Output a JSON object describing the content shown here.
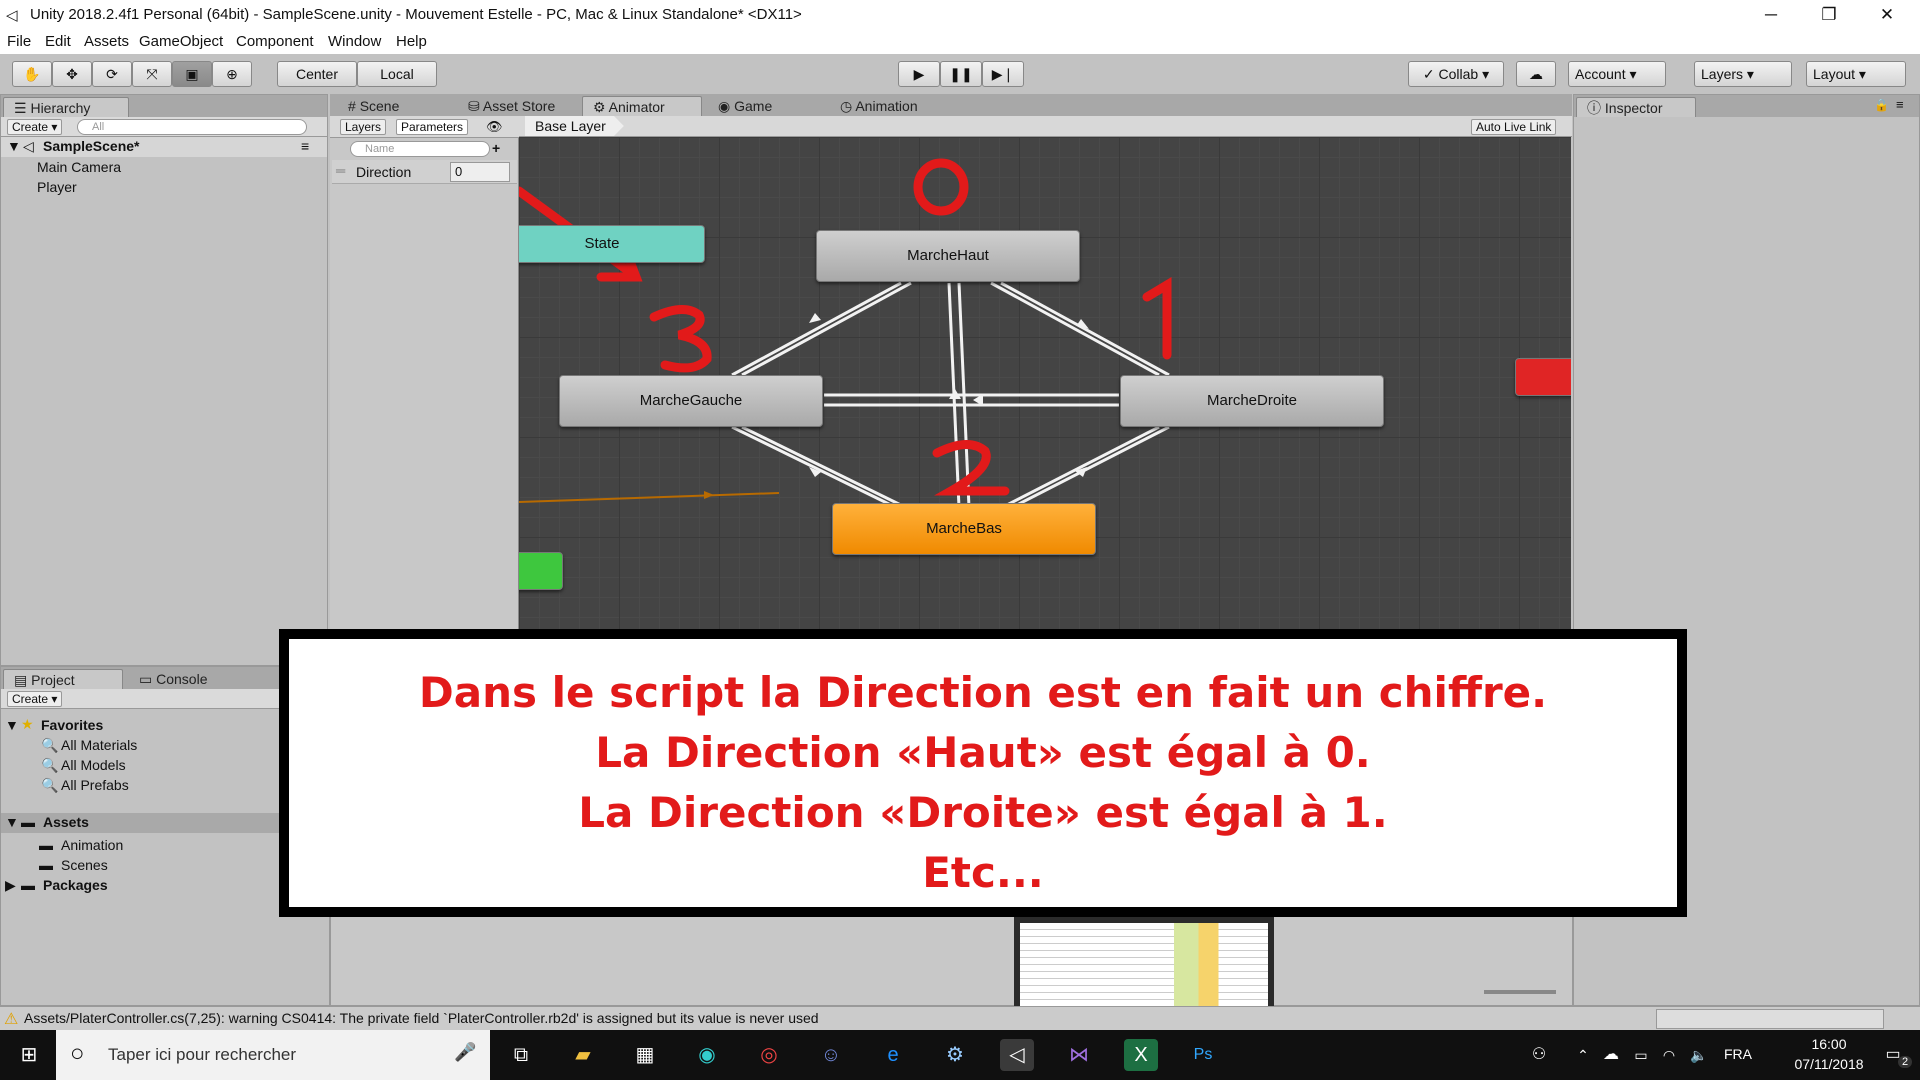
{
  "window": {
    "title": "Unity 2018.2.4f1 Personal (64bit) - SampleScene.unity - Mouvement Estelle - PC, Mac & Linux Standalone* <DX11>",
    "minimize": "─",
    "maximize": "❐",
    "close": "✕"
  },
  "menu": [
    "File",
    "Edit",
    "Assets",
    "GameObject",
    "Component",
    "Window",
    "Help"
  ],
  "toolbar": {
    "center": "Center",
    "local": "Local",
    "collab": "Collab",
    "account": "Account",
    "layers": "Layers",
    "layout": "Layout"
  },
  "hierarchy": {
    "tab": "Hierarchy",
    "create": "Create",
    "search_placeholder": "All",
    "scene": "SampleScene*",
    "items": [
      "Main Camera",
      "Player"
    ]
  },
  "center_tabs": [
    "Scene",
    "Asset Store",
    "Animator",
    "Game",
    "Animation"
  ],
  "animator": {
    "layers_tab": "Layers",
    "parameters_tab": "Parameters",
    "breadcrumb": "Base Layer",
    "auto_live_link": "Auto Live Link",
    "name_placeholder": "Name",
    "param_name": "Direction",
    "param_value": "0",
    "states": {
      "any_state": "State",
      "haut": "MarcheHaut",
      "gauche": "MarcheGauche",
      "droite": "MarcheDroite",
      "bas": "MarcheBas"
    },
    "annotations": {
      "haut": "0",
      "droite": "1",
      "bas": "2",
      "gauche": "3"
    }
  },
  "inspector": {
    "tab": "Inspector"
  },
  "project": {
    "tab_project": "Project",
    "tab_console": "Console",
    "create": "Create",
    "favorites": "Favorites",
    "fav_items": [
      "All Materials",
      "All Models",
      "All Prefabs"
    ],
    "assets": "Assets",
    "asset_items": [
      "Animation",
      "Scenes"
    ],
    "packages": "Packages"
  },
  "caption": {
    "line1": "Dans le script la Direction est en fait un chiffre.",
    "line2": "La Direction «Haut» est égal à 0.",
    "line3": "La Direction «Droite» est égal à 1.",
    "line4": "Etc..."
  },
  "status": {
    "warning": "Assets/PlaterController.cs(7,25): warning CS0414: The private field `PlaterController.rb2d' is assigned but its value is never used"
  },
  "taskbar": {
    "search_placeholder": "Taper ici pour rechercher",
    "lang": "FRA",
    "time": "16:00",
    "date": "07/11/2018",
    "notif_count": "2"
  },
  "colors": {
    "orange_state": "#f08a00",
    "annotation_red": "#e21a1a"
  }
}
